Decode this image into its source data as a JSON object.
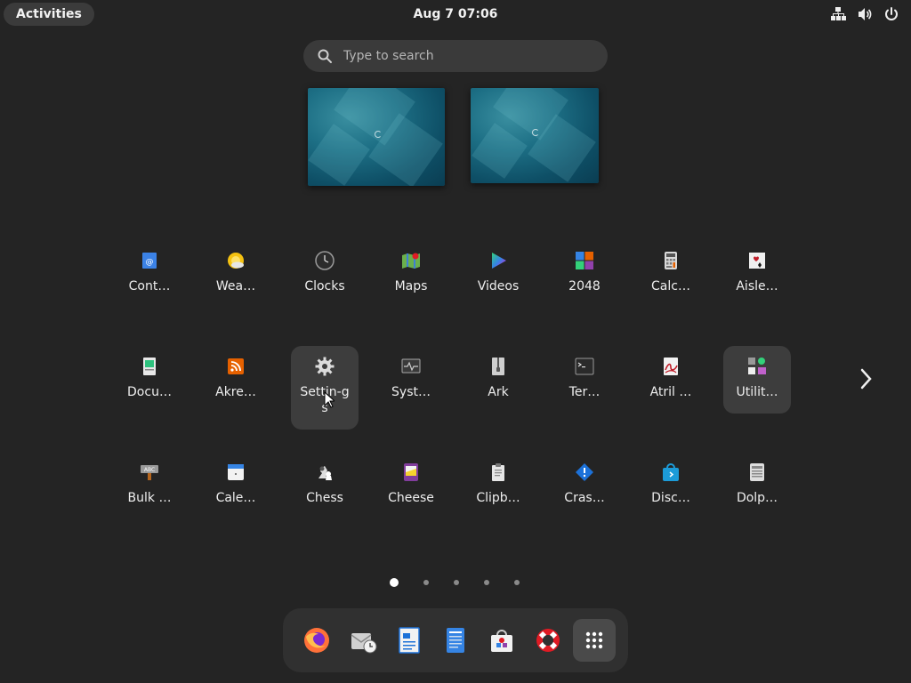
{
  "topbar": {
    "activities_label": "Activities",
    "datetime": "Aug 7  07:06",
    "status_icons": [
      "network-icon",
      "volume-icon",
      "power-icon"
    ]
  },
  "search": {
    "placeholder": "Type to search"
  },
  "workspaces": [
    "workspace-1",
    "workspace-2"
  ],
  "apps": [
    {
      "label": "Cont…",
      "icon": "contacts-icon"
    },
    {
      "label": "Wea…",
      "icon": "weather-icon"
    },
    {
      "label": "Clocks",
      "icon": "clock-icon"
    },
    {
      "label": "Maps",
      "icon": "maps-icon"
    },
    {
      "label": "Videos",
      "icon": "videos-icon"
    },
    {
      "label": "2048",
      "icon": "game-2048-icon"
    },
    {
      "label": "Calc…",
      "icon": "calculator-icon"
    },
    {
      "label": "Aisle…",
      "icon": "aisleriot-cards-icon"
    },
    {
      "label": "Docu…",
      "icon": "document-viewer-icon"
    },
    {
      "label": "Akre…",
      "icon": "rss-feed-icon"
    },
    {
      "label": "Settin-gs",
      "icon": "gear-icon"
    },
    {
      "label": "Syst…",
      "icon": "system-monitor-icon"
    },
    {
      "label": "Ark",
      "icon": "archive-zipper-icon"
    },
    {
      "label": "Ter…",
      "icon": "terminal-icon"
    },
    {
      "label": "Atril …",
      "icon": "atril-pdf-icon"
    },
    {
      "label": "Utilit…",
      "icon": "utilities-folder-icon"
    },
    {
      "label": "Bulk …",
      "icon": "bulk-rename-icon"
    },
    {
      "label": "Cale…",
      "icon": "calendar-icon"
    },
    {
      "label": "Chess",
      "icon": "chess-icon"
    },
    {
      "label": "Cheese",
      "icon": "cheese-camera-icon"
    },
    {
      "label": "Clipb…",
      "icon": "clipboard-icon"
    },
    {
      "label": "Cras…",
      "icon": "crash-report-icon"
    },
    {
      "label": "Disc…",
      "icon": "software-store-icon"
    },
    {
      "label": "Dolp…",
      "icon": "dolphin-file-manager-icon"
    }
  ],
  "pager": {
    "pages": 5,
    "current": 1
  },
  "dock": [
    "firefox-icon",
    "mail-clock-icon",
    "writer-document-icon",
    "text-editor-icon",
    "software-icon",
    "help-lifebuoy-icon",
    "show-apps-grid-icon"
  ],
  "colors": {
    "background": "#242424",
    "highlight": "#3d3d3d",
    "dock": "#303030",
    "search": "#3a3a3a"
  }
}
